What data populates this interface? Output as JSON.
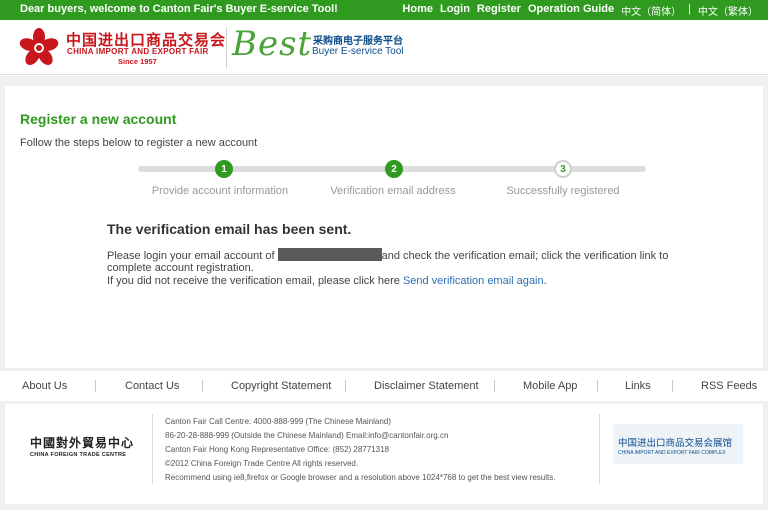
{
  "topbar": {
    "welcome": "Dear buyers, welcome to Canton Fair's Buyer E-service Tool!",
    "home": "Home",
    "login": "Login",
    "register": "Register",
    "guide": "Operation Guide",
    "lang_simplified": "中文（简体）",
    "lang_sep": "|",
    "lang_traditional": "中文（繁体）"
  },
  "header": {
    "logo_cn": "中国进出口商品交易会",
    "logo_en": "CHINA IMPORT AND EXPORT FAIR",
    "logo_since": "Since 1957",
    "best": "Best",
    "best_cn": "采购商电子服务平台",
    "best_en": "Buyer E-service Tool"
  },
  "main": {
    "title": "Register a new account",
    "subtitle": "Follow the steps below to register a new account",
    "steps": [
      {
        "num": "1",
        "label": "Provide account information",
        "state": "done"
      },
      {
        "num": "2",
        "label": "Verification email address",
        "state": "done"
      },
      {
        "num": "3",
        "label": "Successfully registered",
        "state": "todo"
      }
    ],
    "sent_title": "The verification email has been sent.",
    "line1_a": "Please login your email account of",
    "line1_b": "and check the verification email; click the verification link to",
    "line2": "complete account registration.",
    "line3_a": "If you did not receive the verification email, please click here",
    "resend_link": "Send verification email again",
    "line3_b": "."
  },
  "footer_links": [
    "About Us",
    "Contact Us",
    "Copyright Statement",
    "Disclaimer Statement",
    "Mobile App",
    "Links",
    "RSS Feeds"
  ],
  "footer": {
    "cftc_cn": "中國對外貿易中心",
    "cftc_en": "CHINA FOREIGN TRADE CENTRE",
    "info": [
      "Canton Fair Call Centre: 4000-888-999 (The Chinese Mainland)",
      "86-20-28-888-999 (Outside the Chinese Mainland) Email:info@cantonfair.org.cn",
      "Canton Fair Hong Kong Representative Office: (852) 28771318",
      "©2012 China Foreign Trade Centre All rights reserved.",
      "Recommend using ie8,firefox or Google browser and a resolution above 1024*768 to get the best view results."
    ],
    "complex_cn": "中国进出口商品交易会展馆",
    "complex_en": "CHINA IMPORT AND EXPORT FAIR COMPLEX"
  },
  "colors": {
    "brand_green": "#2f9a1f",
    "brand_red": "#c8161d",
    "link_blue": "#2c6eb5"
  }
}
